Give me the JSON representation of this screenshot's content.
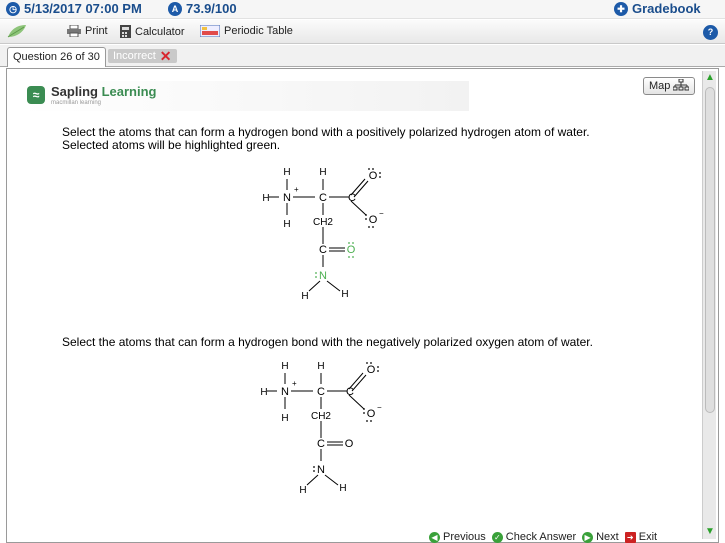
{
  "topbar": {
    "date_time": "5/13/2017 07:00 PM",
    "score": "73.9/100",
    "gradebook_label": "Gradebook"
  },
  "toolbar": {
    "print_label": "Print",
    "calculator_label": "Calculator",
    "periodic_table_label": "Periodic Table"
  },
  "tabs": {
    "question_label": "Question 26 of 30",
    "status_label": "Incorrect"
  },
  "logo": {
    "name_part1": "Sapling",
    "name_part2": "Learning",
    "tagline": "macmillan learning"
  },
  "map_label": "Map",
  "questions": [
    {
      "text_line1": "Select the atoms that can form a hydrogen bond with a positively polarized hydrogen atom of water.",
      "text_line2": "Selected atoms will be highlighted green."
    },
    {
      "text_line1": "Select the atoms that can form a hydrogen bond with the negatively polarized oxygen atom of water."
    }
  ],
  "molecule_labels": {
    "H": "H",
    "N": "N",
    "C": "C",
    "O": "O",
    "CH2": "CH2",
    "plus": "+",
    "minus": "−"
  },
  "bottom": {
    "previous_label": "Previous",
    "check_label": "Check Answer",
    "next_label": "Next",
    "exit_label": "Exit"
  },
  "colors": {
    "accent": "#1a4d8c",
    "selected_green": "#4caf50",
    "incorrect_red": "#d8262e"
  }
}
